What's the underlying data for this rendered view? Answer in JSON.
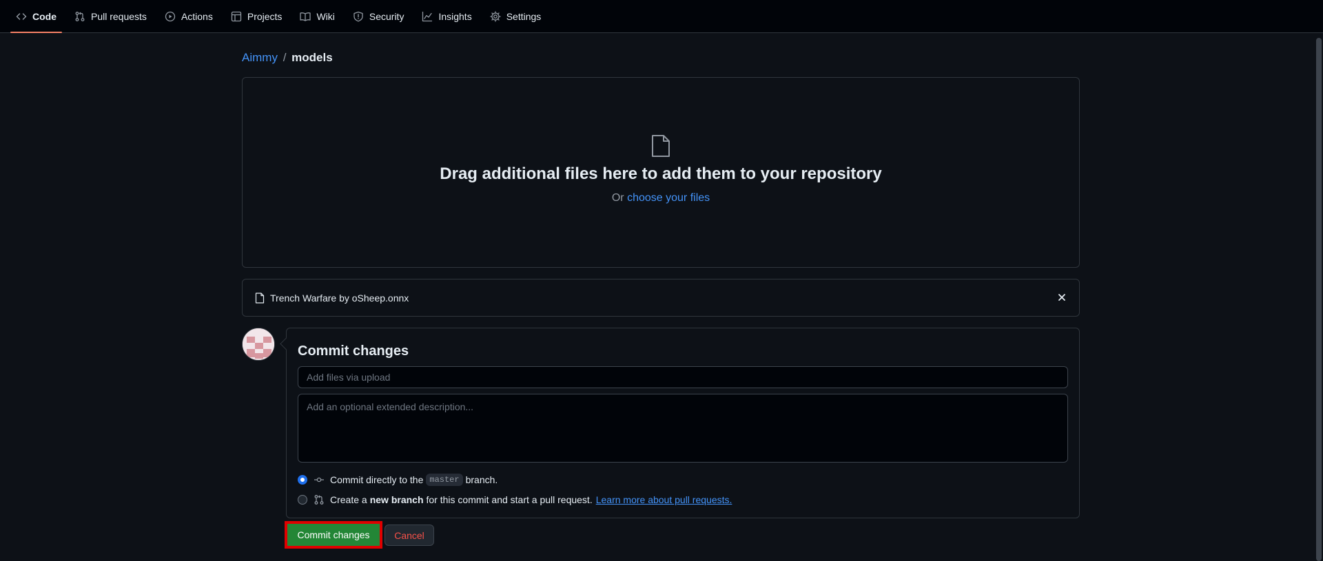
{
  "nav": {
    "tabs": [
      {
        "label": "Code",
        "icon": "code-icon",
        "active": true
      },
      {
        "label": "Pull requests",
        "icon": "pull-request-icon"
      },
      {
        "label": "Actions",
        "icon": "play-icon"
      },
      {
        "label": "Projects",
        "icon": "table-icon"
      },
      {
        "label": "Wiki",
        "icon": "book-icon"
      },
      {
        "label": "Security",
        "icon": "shield-icon"
      },
      {
        "label": "Insights",
        "icon": "graph-icon"
      },
      {
        "label": "Settings",
        "icon": "gear-icon"
      }
    ]
  },
  "breadcrumb": {
    "owner": "Aimmy",
    "separator": "/",
    "repo": "models"
  },
  "dropzone": {
    "title": "Drag additional files here to add them to your repository",
    "prefix": "Or",
    "link": "choose your files"
  },
  "file": {
    "name": "Trench Warfare by oSheep.onnx"
  },
  "commit": {
    "title": "Commit changes",
    "summary_placeholder": "Add files via upload",
    "description_placeholder": "Add an optional extended description...",
    "option_direct": {
      "before": "Commit directly to the",
      "branch": "master",
      "after": "branch."
    },
    "option_new": {
      "before": "Create a",
      "bold": "new branch",
      "after": "for this commit and start a pull request.",
      "link": "Learn more about pull requests."
    },
    "selected_option": "direct",
    "commit_button": "Commit changes",
    "cancel_button": "Cancel"
  },
  "colors": {
    "background": "#0d1117",
    "link": "#4493f8",
    "commit_button": "#238636",
    "cancel_text": "#f85149",
    "highlight_border": "#e00000",
    "active_tab_underline": "#f78166"
  }
}
